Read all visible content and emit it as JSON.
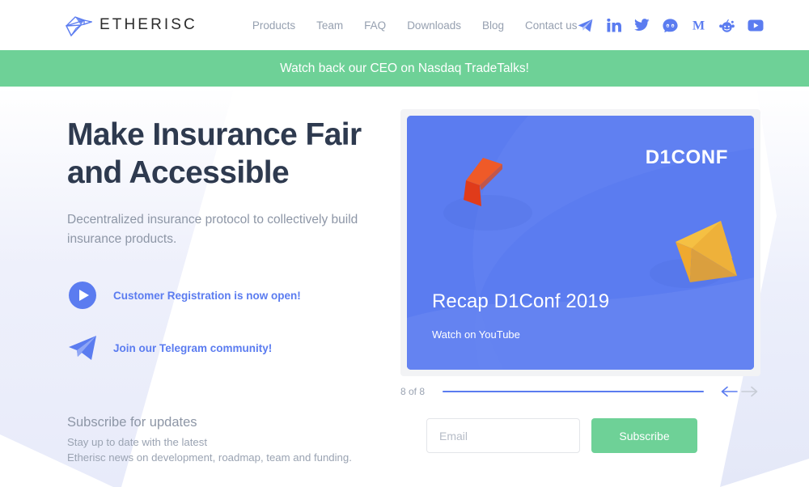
{
  "header": {
    "brand_name": "ETHERISC",
    "nav": [
      {
        "label": "Products"
      },
      {
        "label": "Team"
      },
      {
        "label": "FAQ"
      },
      {
        "label": "Downloads"
      },
      {
        "label": "Blog"
      },
      {
        "label": "Contact us"
      }
    ],
    "socials": [
      {
        "name": "telegram-icon"
      },
      {
        "name": "linkedin-icon"
      },
      {
        "name": "twitter-icon"
      },
      {
        "name": "github-icon"
      },
      {
        "name": "medium-icon"
      },
      {
        "name": "reddit-icon"
      },
      {
        "name": "youtube-icon"
      }
    ]
  },
  "banner": {
    "text": "Watch back our CEO on Nasdaq TradeTalks!",
    "background": "#6ed197"
  },
  "hero": {
    "headline_line1": "Make Insurance Fair",
    "headline_line2": "and Accessible",
    "subhead": "Decentralized insurance protocol to collectively build insurance products.",
    "ctas": [
      {
        "icon": "play-circle-icon",
        "label": "Customer Registration is now open!"
      },
      {
        "icon": "telegram-paper-plane-icon",
        "label": "Join our Telegram community!"
      }
    ]
  },
  "subscribe_block": {
    "title": "Subscribe for updates",
    "desc_line1": "Stay up to date with the latest",
    "desc_line2": "Etherisc news on development, roadmap, team and funding."
  },
  "card": {
    "logo": "D1CONF",
    "title": "Recap D1Conf 2019",
    "subtitle": "Watch on YouTube",
    "background": "#5b7cf0"
  },
  "carousel": {
    "count_label": "8 of 8",
    "progress_percent": 100,
    "prev_label": "previous-slide",
    "next_label": "next-slide",
    "prev_color": "#5b7cf0",
    "next_color": "#c7ccd6"
  },
  "form": {
    "email_placeholder": "Email",
    "email_value": "",
    "submit_label": "Subscribe"
  },
  "colors": {
    "accent_blue": "#5b7cf0",
    "accent_green": "#6ed197",
    "heading": "#2e3a4f",
    "muted": "#8d96a6"
  }
}
